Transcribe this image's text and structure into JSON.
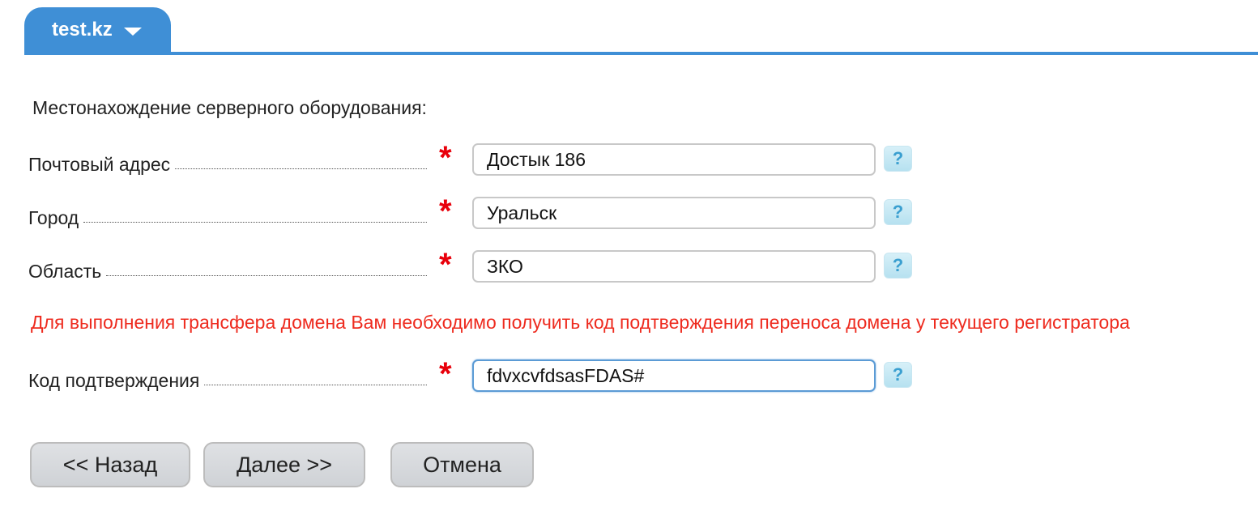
{
  "tab": {
    "label": "test.kz",
    "caret_icon": "chevron-down-icon"
  },
  "section_title": "Местонахождение серверного оборудования:",
  "fields": [
    {
      "label": "Почтовый адрес",
      "value": "Достык 186",
      "required": true,
      "help": "?"
    },
    {
      "label": "Город",
      "value": "Уральск",
      "required": true,
      "help": "?"
    },
    {
      "label": "Область",
      "value": "ЗКО",
      "required": true,
      "help": "?"
    }
  ],
  "notice": "Для выполнения трансфера домена Вам необходимо получить код подтверждения переноса домена у текущего регистратора",
  "code_field": {
    "label": "Код подтверждения",
    "value": "fdvxcvfdsasFDAS#",
    "required": true,
    "help": "?"
  },
  "required_mark": "*",
  "buttons": {
    "back": "<< Назад",
    "next": "Далее >>",
    "cancel": "Отмена"
  },
  "colors": {
    "accent": "#3f8fd6",
    "required": "#e8000b",
    "notice": "#ee2b1f"
  }
}
